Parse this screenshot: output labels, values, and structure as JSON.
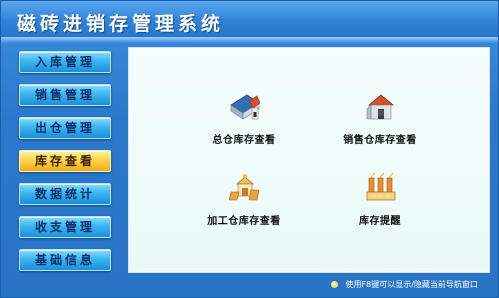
{
  "app": {
    "title": "磁砖进销存管理系统"
  },
  "nav": {
    "items": [
      {
        "label": "入库管理"
      },
      {
        "label": "销售管理"
      },
      {
        "label": "出仓管理"
      },
      {
        "label": "库存查看",
        "active": true
      },
      {
        "label": "数据统计"
      },
      {
        "label": "收支管理"
      },
      {
        "label": "基础信息"
      }
    ]
  },
  "panel": {
    "tiles": [
      {
        "label": "总仓库存查看",
        "icon": "warehouse-blue-roof-icon"
      },
      {
        "label": "销售仓库存查看",
        "icon": "warehouse-orange-roof-icon"
      },
      {
        "label": "加工仓库存查看",
        "icon": "processing-house-icon"
      },
      {
        "label": "库存提醒",
        "icon": "factory-alert-icon"
      }
    ]
  },
  "status": {
    "text": "使用F8键可以显示/隐藏当前导航窗口"
  },
  "colors": {
    "background": "#2f7fd0",
    "panel": "#eaf9f6",
    "nav_button": "#3bb5f0",
    "nav_button_active": "#ffd54a"
  }
}
